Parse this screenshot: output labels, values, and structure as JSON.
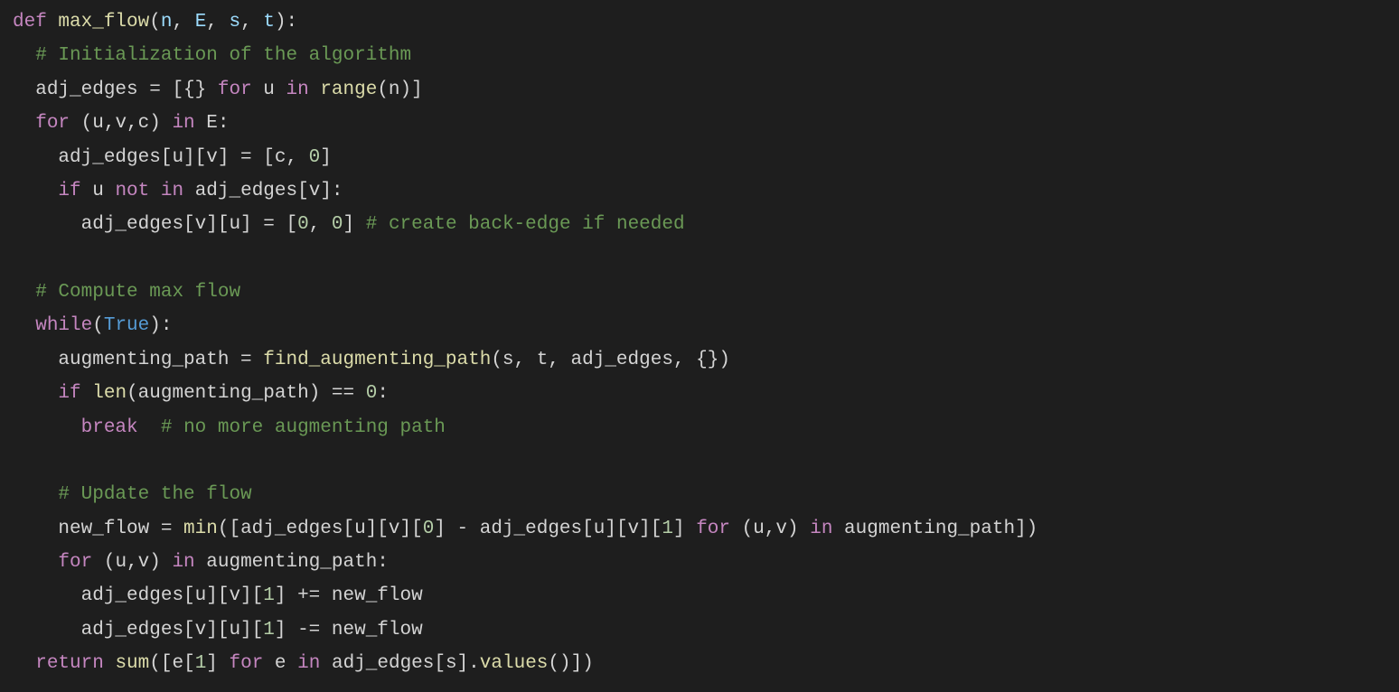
{
  "language": "python",
  "function_name": "max_flow",
  "parameters": [
    "n",
    "E",
    "s",
    "t"
  ],
  "code_lines": [
    {
      "indent": 0,
      "tokens": [
        {
          "t": "def ",
          "c": "kw"
        },
        {
          "t": "max_flow",
          "c": "fn"
        },
        {
          "t": "(",
          "c": "ident"
        },
        {
          "t": "n",
          "c": "param"
        },
        {
          "t": ", ",
          "c": "ident"
        },
        {
          "t": "E",
          "c": "param"
        },
        {
          "t": ", ",
          "c": "ident"
        },
        {
          "t": "s",
          "c": "param"
        },
        {
          "t": ", ",
          "c": "ident"
        },
        {
          "t": "t",
          "c": "param"
        },
        {
          "t": "):",
          "c": "ident"
        }
      ]
    },
    {
      "indent": 2,
      "tokens": [
        {
          "t": "# Initialization of the algorithm",
          "c": "comment"
        }
      ]
    },
    {
      "indent": 2,
      "tokens": [
        {
          "t": "adj_edges = [{} ",
          "c": "ident"
        },
        {
          "t": "for",
          "c": "kw"
        },
        {
          "t": " u ",
          "c": "ident"
        },
        {
          "t": "in",
          "c": "kw"
        },
        {
          "t": " ",
          "c": "ident"
        },
        {
          "t": "range",
          "c": "fn"
        },
        {
          "t": "(n)]",
          "c": "ident"
        }
      ]
    },
    {
      "indent": 2,
      "tokens": [
        {
          "t": "for",
          "c": "kw"
        },
        {
          "t": " (u,v,c) ",
          "c": "ident"
        },
        {
          "t": "in",
          "c": "kw"
        },
        {
          "t": " E:",
          "c": "ident"
        }
      ]
    },
    {
      "indent": 4,
      "tokens": [
        {
          "t": "adj_edges[u][v] = [c, ",
          "c": "ident"
        },
        {
          "t": "0",
          "c": "num"
        },
        {
          "t": "]",
          "c": "ident"
        }
      ]
    },
    {
      "indent": 4,
      "tokens": [
        {
          "t": "if",
          "c": "kw"
        },
        {
          "t": " u ",
          "c": "ident"
        },
        {
          "t": "not",
          "c": "kw"
        },
        {
          "t": " ",
          "c": "ident"
        },
        {
          "t": "in",
          "c": "kw"
        },
        {
          "t": " adj_edges[v]:",
          "c": "ident"
        }
      ]
    },
    {
      "indent": 6,
      "tokens": [
        {
          "t": "adj_edges[v][u] = [",
          "c": "ident"
        },
        {
          "t": "0",
          "c": "num"
        },
        {
          "t": ", ",
          "c": "ident"
        },
        {
          "t": "0",
          "c": "num"
        },
        {
          "t": "] ",
          "c": "ident"
        },
        {
          "t": "# create back-edge if needed",
          "c": "comment"
        }
      ]
    },
    {
      "indent": 0,
      "tokens": []
    },
    {
      "indent": 2,
      "tokens": [
        {
          "t": "# Compute max flow",
          "c": "comment"
        }
      ]
    },
    {
      "indent": 2,
      "tokens": [
        {
          "t": "while",
          "c": "kw"
        },
        {
          "t": "(",
          "c": "ident"
        },
        {
          "t": "True",
          "c": "const"
        },
        {
          "t": "):",
          "c": "ident"
        }
      ]
    },
    {
      "indent": 4,
      "tokens": [
        {
          "t": "augmenting_path = ",
          "c": "ident"
        },
        {
          "t": "find_augmenting_path",
          "c": "fn"
        },
        {
          "t": "(s, t, adj_edges, {})",
          "c": "ident"
        }
      ]
    },
    {
      "indent": 4,
      "tokens": [
        {
          "t": "if",
          "c": "kw"
        },
        {
          "t": " ",
          "c": "ident"
        },
        {
          "t": "len",
          "c": "fn"
        },
        {
          "t": "(augmenting_path) == ",
          "c": "ident"
        },
        {
          "t": "0",
          "c": "num"
        },
        {
          "t": ":",
          "c": "ident"
        }
      ]
    },
    {
      "indent": 6,
      "tokens": [
        {
          "t": "break",
          "c": "kw"
        },
        {
          "t": "  ",
          "c": "ident"
        },
        {
          "t": "# no more augmenting path",
          "c": "comment"
        }
      ]
    },
    {
      "indent": 0,
      "tokens": []
    },
    {
      "indent": 4,
      "tokens": [
        {
          "t": "# Update the flow",
          "c": "comment"
        }
      ]
    },
    {
      "indent": 4,
      "tokens": [
        {
          "t": "new_flow = ",
          "c": "ident"
        },
        {
          "t": "min",
          "c": "fn"
        },
        {
          "t": "([adj_edges[u][v][",
          "c": "ident"
        },
        {
          "t": "0",
          "c": "num"
        },
        {
          "t": "] - adj_edges[u][v][",
          "c": "ident"
        },
        {
          "t": "1",
          "c": "num"
        },
        {
          "t": "] ",
          "c": "ident"
        },
        {
          "t": "for",
          "c": "kw"
        },
        {
          "t": " (u,v) ",
          "c": "ident"
        },
        {
          "t": "in",
          "c": "kw"
        },
        {
          "t": " augmenting_path])",
          "c": "ident"
        }
      ]
    },
    {
      "indent": 4,
      "tokens": [
        {
          "t": "for",
          "c": "kw"
        },
        {
          "t": " (u,v) ",
          "c": "ident"
        },
        {
          "t": "in",
          "c": "kw"
        },
        {
          "t": " augmenting_path:",
          "c": "ident"
        }
      ]
    },
    {
      "indent": 6,
      "tokens": [
        {
          "t": "adj_edges[u][v][",
          "c": "ident"
        },
        {
          "t": "1",
          "c": "num"
        },
        {
          "t": "] += new_flow",
          "c": "ident"
        }
      ]
    },
    {
      "indent": 6,
      "tokens": [
        {
          "t": "adj_edges[v][u][",
          "c": "ident"
        },
        {
          "t": "1",
          "c": "num"
        },
        {
          "t": "] -= new_flow",
          "c": "ident"
        }
      ]
    },
    {
      "indent": 2,
      "tokens": [
        {
          "t": "return",
          "c": "kw"
        },
        {
          "t": " ",
          "c": "ident"
        },
        {
          "t": "sum",
          "c": "fn"
        },
        {
          "t": "([e[",
          "c": "ident"
        },
        {
          "t": "1",
          "c": "num"
        },
        {
          "t": "] ",
          "c": "ident"
        },
        {
          "t": "for",
          "c": "kw"
        },
        {
          "t": " e ",
          "c": "ident"
        },
        {
          "t": "in",
          "c": "kw"
        },
        {
          "t": " adj_edges[s].",
          "c": "ident"
        },
        {
          "t": "values",
          "c": "fn"
        },
        {
          "t": "()])",
          "c": "ident"
        }
      ]
    }
  ]
}
